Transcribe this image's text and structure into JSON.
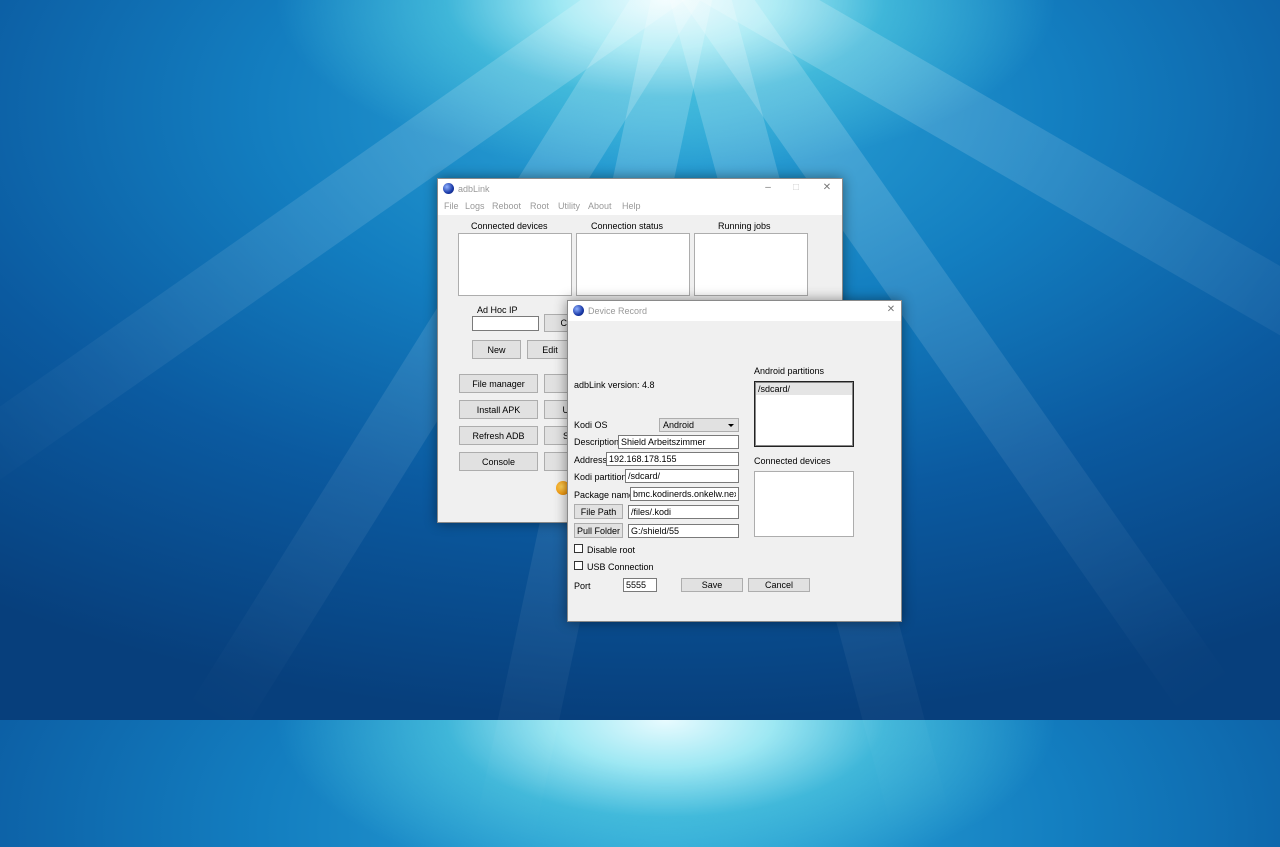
{
  "main_window": {
    "title": "adbLink",
    "menu": [
      "File",
      "Logs",
      "Reboot",
      "Root",
      "Utility",
      "About",
      "Help"
    ],
    "labels": {
      "connected_devices": "Connected devices",
      "connection_status": "Connection status",
      "running_jobs": "Running jobs",
      "ad_hoc_ip": "Ad Hoc IP"
    },
    "buttons": {
      "connect_partial": "Cl",
      "new": "New",
      "edit": "Edit",
      "file_manager": "File manager",
      "install_apk": "Install APK",
      "refresh_adb": "Refresh ADB",
      "console": "Console",
      "partial_1": "",
      "partial_2": "U",
      "partial_3": "S",
      "partial_4": ""
    }
  },
  "dialog": {
    "title": "Device Record",
    "version_text": "adbLink version: 4.8",
    "kodi_os_label": "Kodi OS",
    "kodi_os_value": "Android",
    "description_label": "Description",
    "description_value": "Shield Arbeitszimmer",
    "address_label": "Address",
    "address_value": "192.168.178.155",
    "kodi_partition_label": "Kodi partition",
    "kodi_partition_value": "/sdcard/",
    "package_name_label": "Package name",
    "package_name_value": "bmc.kodinerds.onkelw.nexus",
    "file_path_button": "File Path",
    "file_path_value": "/files/.kodi",
    "pull_folder_button": "Pull Folder",
    "pull_folder_value": "G:/shield/55",
    "disable_root_label": "Disable root",
    "usb_connection_label": "USB Connection",
    "port_label": "Port",
    "port_value": "5555",
    "save_button": "Save",
    "cancel_button": "Cancel",
    "android_partitions_label": "Android partitions",
    "android_partitions": [
      "/sdcard/"
    ],
    "connected_devices_label": "Connected devices"
  }
}
